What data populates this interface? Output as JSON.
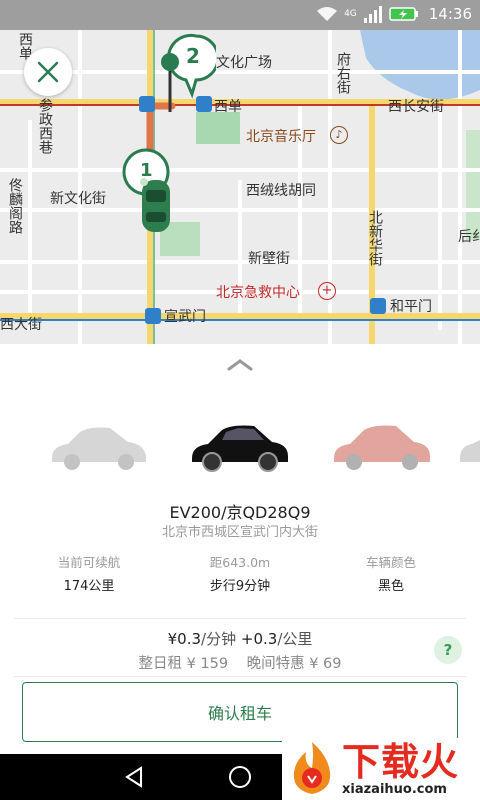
{
  "status_bar": {
    "time": "14:36",
    "network": "4G"
  },
  "map": {
    "labels": {
      "xi_tian": "西单",
      "culture_square": "文化广场",
      "fu_you_jie": "府右街",
      "can_zheng_xi_xiang": "参政西巷",
      "xi_dan": "西单",
      "xi_chang_an_jie": "西长安街",
      "concert_hall": "北京音乐厅",
      "xin_wen_hua_jie": "新文化街",
      "xi_rong_xian": "西绒线胡同",
      "tong_lin_ge_lu": "佟麟阁路",
      "bei_xin_hua_jie": "北新华街",
      "hou_jie": "后纟",
      "xin_bi_jie": "新壁街",
      "emergency_center": "北京急救中心",
      "xi_da_jie": "西大街",
      "xuan_wu_men": "宣武门",
      "he_ping_men": "和平门"
    },
    "pin_number": "2",
    "car_pin_number": "1"
  },
  "sheet": {
    "car_name": "EV200/京QD28Q9",
    "car_address": "北京市西城区宣武门内大街",
    "stats": [
      {
        "label": "当前可续航",
        "value": "174公里"
      },
      {
        "label": "距643.0m",
        "value": "步行9分钟"
      },
      {
        "label": "车辆颜色",
        "value": "黑色"
      }
    ],
    "price_per_min": "¥0.3",
    "unit_min": "/分钟",
    "plus": "+",
    "price_per_km": "0.3",
    "unit_km": "/公里",
    "day_rent_label": "整日租",
    "day_rent_price": "¥ 159",
    "night_label": "晚间特惠",
    "night_price": "¥ 69",
    "help": "?",
    "confirm": "确认租车"
  },
  "watermark": {
    "text": "下载火",
    "url": "xiazaihuo.com"
  },
  "colors": {
    "primary_green": "#2e7d4f",
    "map_road_yellow": "#f5d76e",
    "route_orange": "#e0744a"
  }
}
